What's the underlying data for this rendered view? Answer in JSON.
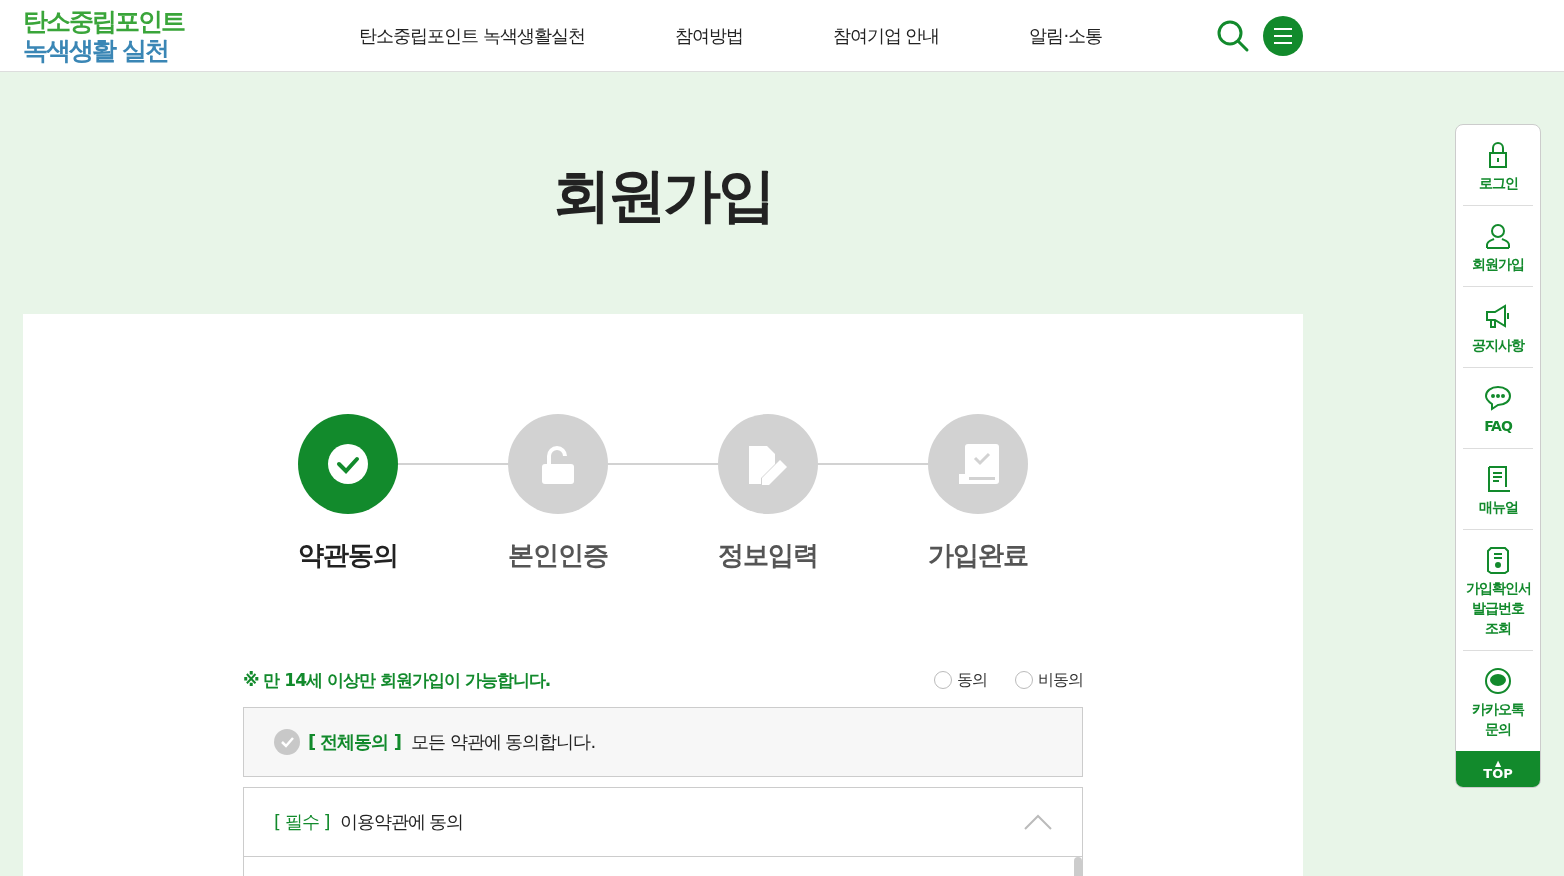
{
  "logo": {
    "line1": "탄소중립포인트",
    "line2": "녹색생활 실천"
  },
  "nav": [
    "탄소중립포인트 녹색생활실천",
    "참여방법",
    "참여기업 안내",
    "알림·소통"
  ],
  "page_title": "회원가입",
  "steps": [
    {
      "label": "약관동의",
      "selected": true
    },
    {
      "label": "본인인증",
      "selected": false
    },
    {
      "label": "정보입력",
      "selected": false
    },
    {
      "label": "가입완료",
      "selected": false
    }
  ],
  "notice": "※ 만 14세 이상만 회원가입이 가능합니다.",
  "age_options": [
    {
      "label": "동의",
      "selected": false
    },
    {
      "label": "비동의",
      "selected": false
    }
  ],
  "agree_all": {
    "checked": false,
    "tag": "[ 전체동의 ]",
    "text": "모든 약관에 동의합니다."
  },
  "terms": [
    {
      "tag": "[ 필수 ]",
      "text": "이용약관에 동의",
      "expanded": true
    }
  ],
  "quick_menu": [
    {
      "label": "로그인"
    },
    {
      "label": "회원가입"
    },
    {
      "label": "공지사항"
    },
    {
      "label": "FAQ"
    },
    {
      "label": "매뉴얼"
    },
    {
      "label": "가입확인서 발급번호 조회"
    },
    {
      "label": "카카오톡 문의"
    }
  ],
  "top_button": {
    "arrow": "▲",
    "label": "TOP"
  }
}
